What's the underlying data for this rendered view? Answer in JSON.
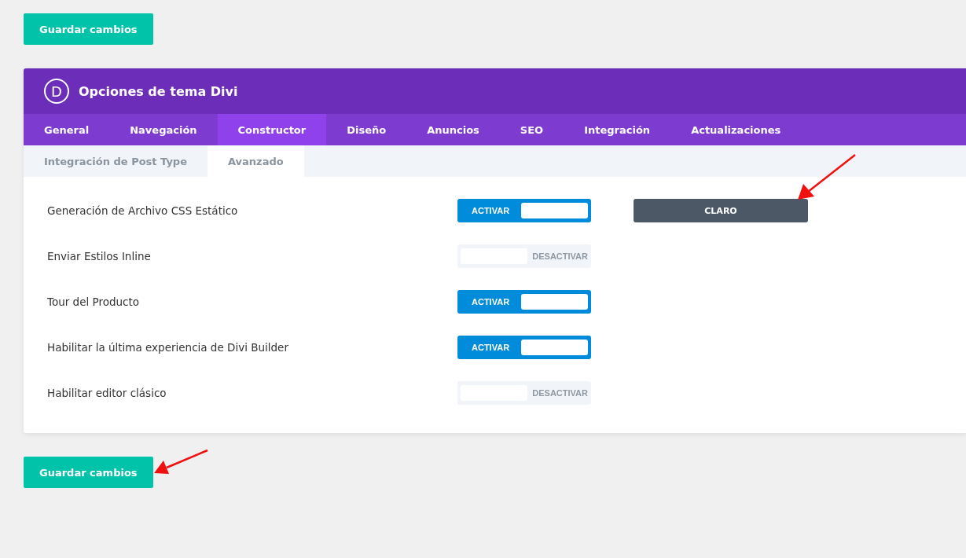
{
  "save_button_top": "Guardar cambios",
  "panel": {
    "title": "Opciones de tema Divi",
    "logo": "D",
    "tabs": [
      {
        "label": "General",
        "selected": false
      },
      {
        "label": "Navegación",
        "selected": false
      },
      {
        "label": "Constructor",
        "selected": true
      },
      {
        "label": "Diseño",
        "selected": false
      },
      {
        "label": "Anuncios",
        "selected": false
      },
      {
        "label": "SEO",
        "selected": false
      },
      {
        "label": "Integración",
        "selected": false
      },
      {
        "label": "Actualizaciones",
        "selected": false
      }
    ],
    "subtabs": [
      {
        "label": "Integración de Post Type",
        "selected": false
      },
      {
        "label": "Avanzado",
        "selected": true
      }
    ],
    "settings": [
      {
        "label": "Generación de Archivo CSS Estático",
        "on": true,
        "toggle_text": "ACTIVAR",
        "extra_button": "CLARO"
      },
      {
        "label": "Enviar Estilos Inline",
        "on": false,
        "toggle_text": "DESACTIVAR"
      },
      {
        "label": "Tour del Producto",
        "on": true,
        "toggle_text": "ACTIVAR"
      },
      {
        "label": "Habilitar la última experiencia de Divi Builder",
        "on": true,
        "toggle_text": "ACTIVAR"
      },
      {
        "label": "Habilitar editor clásico",
        "on": false,
        "toggle_text": "DESACTIVAR"
      }
    ]
  },
  "save_button_bottom": "Guardar cambios"
}
